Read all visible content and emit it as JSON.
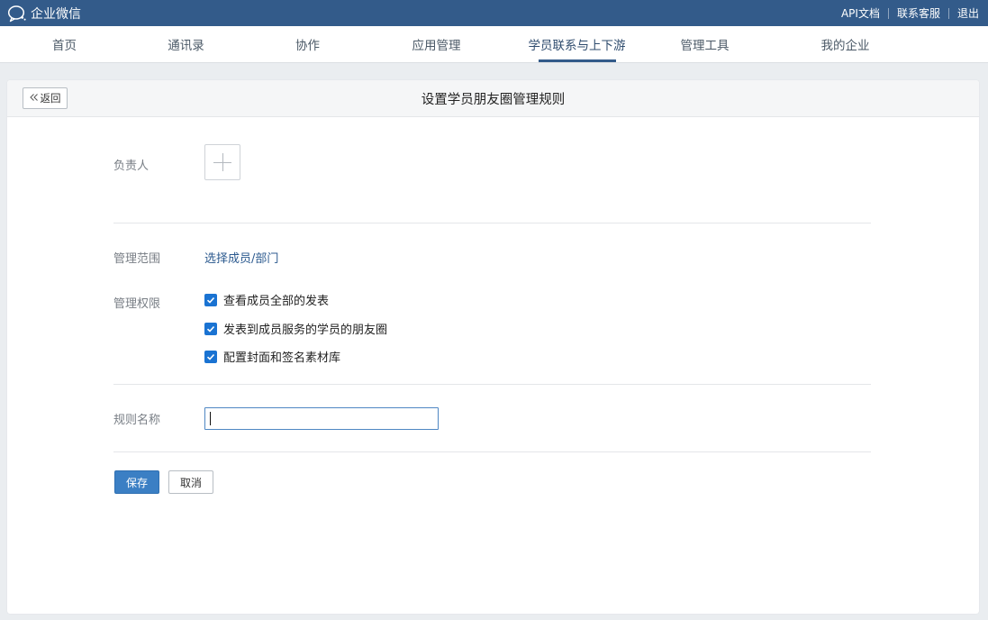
{
  "topbar": {
    "brand": "企业微信",
    "links": [
      "API文档",
      "联系客服",
      "退出"
    ]
  },
  "nav": {
    "items": [
      "首页",
      "通讯录",
      "协作",
      "应用管理",
      "学员联系与上下游",
      "管理工具",
      "我的企业"
    ],
    "active_index": 4
  },
  "page": {
    "back_label": "返回",
    "title": "设置学员朋友圈管理规则"
  },
  "form": {
    "owner_label": "负责人",
    "scope_label": "管理范围",
    "scope_link": "选择成员/部门",
    "perm_label": "管理权限",
    "permissions": [
      {
        "label": "查看成员全部的发表",
        "checked": true
      },
      {
        "label": "发表到成员服务的学员的朋友圈",
        "checked": true
      },
      {
        "label": "配置封面和签名素材库",
        "checked": true
      }
    ],
    "name_label": "规则名称",
    "name_value": "",
    "save_label": "保存",
    "cancel_label": "取消"
  },
  "colors": {
    "topbar": "#335b8a",
    "accent": "#3b7fc4",
    "checkbox": "#1a73d2",
    "link": "#2c5a8f"
  }
}
